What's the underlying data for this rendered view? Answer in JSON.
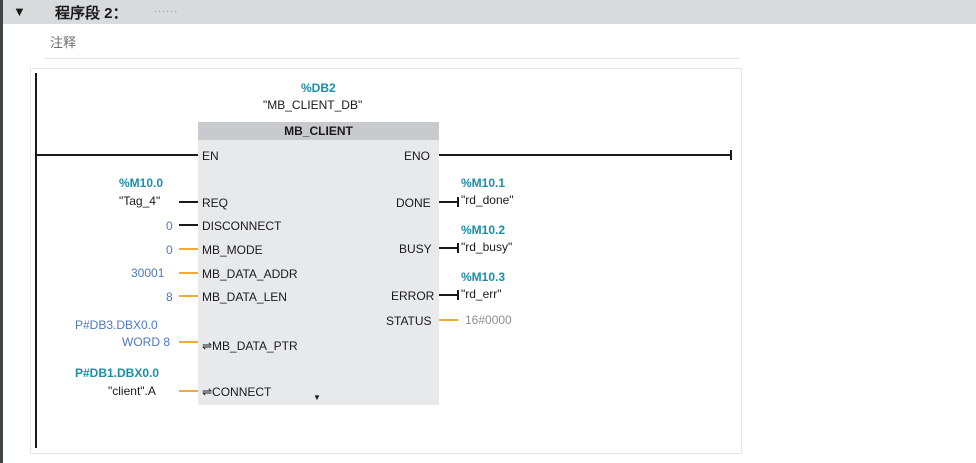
{
  "network": {
    "toggle_glyph": "▼",
    "title": "程序段 2：",
    "title_dots": "......",
    "comment": "注释"
  },
  "block": {
    "instance_address": "%DB2",
    "instance_name": "\"MB_CLIENT_DB\"",
    "type_name": "MB_CLIENT",
    "pins": {
      "en": "EN",
      "eno": "ENO",
      "req": "REQ",
      "disconnect": "DISCONNECT",
      "mb_mode": "MB_MODE",
      "mb_data_addr": "MB_DATA_ADDR",
      "mb_data_len": "MB_DATA_LEN",
      "mb_data_ptr": "⇌MB_DATA_PTR",
      "connect": "⇌CONNECT",
      "done": "DONE",
      "busy": "BUSY",
      "error": "ERROR",
      "status": "STATUS"
    },
    "expand_glyph": "▼"
  },
  "inputs": {
    "req_addr": "%M10.0",
    "req_tag": "\"Tag_4\"",
    "disconnect_value": "0",
    "mb_mode_value": "0",
    "mb_data_addr_value": "30001",
    "mb_data_len_value": "8",
    "mb_data_ptr_line1": "P#DB3.DBX0.0",
    "mb_data_ptr_line2": "WORD 8",
    "connect_addr": "P#DB1.DBX0.0",
    "connect_tag": "\"client\".A"
  },
  "outputs": {
    "done_addr": "%M10.1",
    "done_tag": "\"rd_done\"",
    "busy_addr": "%M10.2",
    "busy_tag": "\"rd_busy\"",
    "error_addr": "%M10.3",
    "error_tag": "\"rd_err\"",
    "status_value": "16#0000"
  },
  "colors": {
    "address_teal": "#1b8ea5",
    "constant_blue": "#4d79bd",
    "wire_orange": "#f2a935",
    "wire_black": "#1a1a1a",
    "block_body": "#e8e9eb",
    "block_header": "#c8cacd"
  }
}
